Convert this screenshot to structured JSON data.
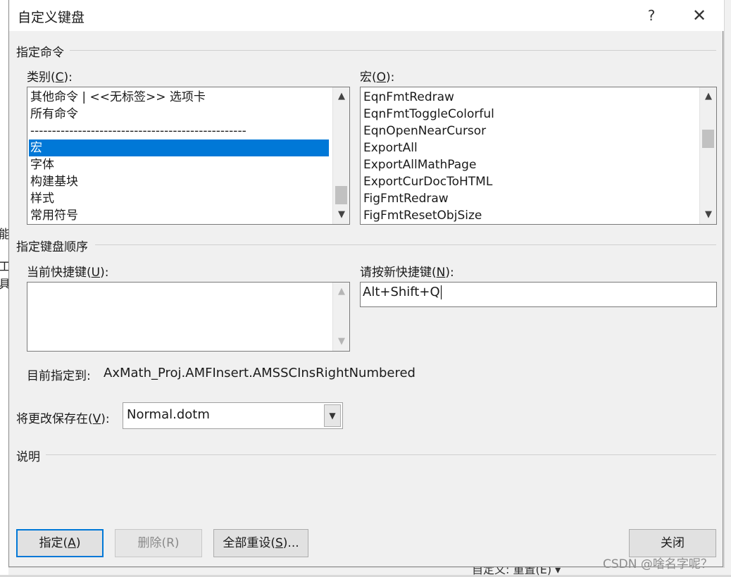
{
  "dialog": {
    "title": "自定义键盘",
    "help": "?",
    "close_glyph": "✕"
  },
  "background": {
    "left_frag_1": "能",
    "left_frag_2": "工具",
    "bottom_text": "自定义:    重置(E) ▾"
  },
  "specify_command": {
    "section_title": "指定命令",
    "categories": {
      "label": "类别(",
      "accel": "C",
      "label_end": "):",
      "items": [
        "其他命令 | <<无标签>> 选项卡",
        "所有命令",
        "--------------------------------------------------",
        "宏",
        "字体",
        "构建基块",
        "样式",
        "常用符号"
      ],
      "selected_index": 3
    },
    "macros": {
      "label": "宏(",
      "accel": "O",
      "label_end": "):",
      "items": [
        "EqnFmtRedraw",
        "EqnFmtToggleColorful",
        "EqnOpenNearCursor",
        "ExportAll",
        "ExportAllMathPage",
        "ExportCurDocToHTML",
        "FigFmtRedraw",
        "FigFmtResetObjSize"
      ]
    }
  },
  "keyboard_sequence": {
    "section_title": "指定键盘顺序",
    "current_keys": {
      "label": "当前快捷键(",
      "accel": "U",
      "label_end": "):"
    },
    "new_key": {
      "label": "请按新快捷键(",
      "accel": "N",
      "label_end": "):",
      "value": "Alt+Shift+Q"
    },
    "currently_assigned_label": "目前指定到:",
    "currently_assigned_value": "AxMath_Proj.AMFInsert.AMSSCInsRightNumbered"
  },
  "save_changes": {
    "label": "将更改保存在(",
    "accel": "V",
    "label_end": "):",
    "value": "Normal.dotm"
  },
  "description": {
    "section_title": "说明"
  },
  "buttons": {
    "assign": {
      "label": "指定(",
      "accel": "A",
      "label_end": ")"
    },
    "remove": {
      "label": "删除(R)"
    },
    "reset_all": {
      "label": "全部重设(",
      "accel": "S",
      "label_end": ")..."
    },
    "close": {
      "label": "关闭"
    }
  },
  "watermark": "CSDN @啥名字呢？"
}
